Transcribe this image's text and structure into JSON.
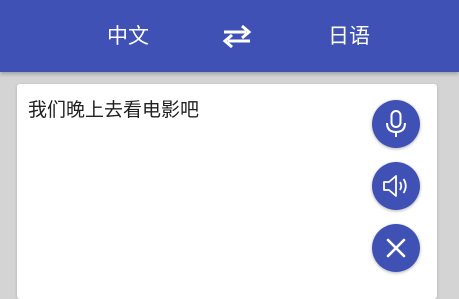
{
  "header": {
    "source_lang": "中文",
    "target_lang": "日语",
    "swap_icon": "swap-arrows-icon",
    "background": "#3f51b5"
  },
  "input": {
    "text": "我们晚上去看电影吧"
  },
  "actions": {
    "mic_icon": "microphone-icon",
    "speaker_icon": "speaker-icon",
    "clear_icon": "close-icon",
    "accent": "#3f51b5"
  }
}
